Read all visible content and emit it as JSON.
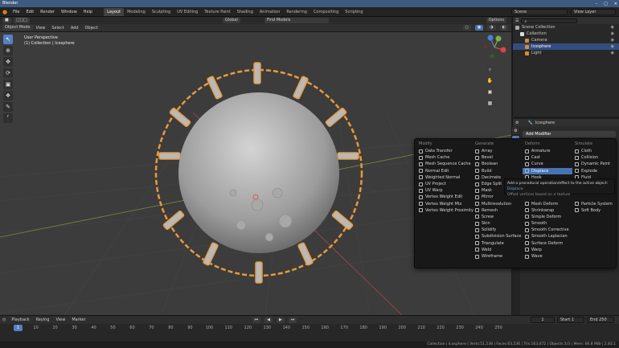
{
  "window": {
    "title": "Blender"
  },
  "menu": [
    "File",
    "Edit",
    "Render",
    "Window",
    "Help"
  ],
  "workspaces": [
    "Layout",
    "Modeling",
    "Sculpting",
    "UV Editing",
    "Texture Paint",
    "Shading",
    "Animation",
    "Rendering",
    "Compositing",
    "Scripting"
  ],
  "active_workspace": "Layout",
  "scene": {
    "label": "Scene",
    "view_layer": "View Layer"
  },
  "viewport": {
    "mode": "Object Mode",
    "menus": [
      "View",
      "Select",
      "Add",
      "Object"
    ],
    "transform": "Global",
    "snap": "Find Models",
    "options": "Options",
    "overlay_line1": "User Perspective",
    "overlay_line2": "(1) Collection | Icosphere"
  },
  "outliner": {
    "rows": [
      {
        "label": "Scene Collection",
        "selected": false,
        "color": "#aaaaaa"
      },
      {
        "label": "Collection",
        "selected": false,
        "color": "#dddddd"
      },
      {
        "label": "Camera",
        "selected": false,
        "color": "#d58c3f"
      },
      {
        "label": "Icosphere",
        "selected": true,
        "color": "#d58c3f"
      },
      {
        "label": "Light",
        "selected": false,
        "color": "#d58c3f"
      }
    ]
  },
  "properties": {
    "object_name": "Icosphere",
    "add_modifier": "Add Modifier"
  },
  "modifier_menu": {
    "columns": [
      {
        "title": "Modify",
        "items": [
          "Data Transfer",
          "Mesh Cache",
          "Mesh Sequence Cache",
          "Normal Edit",
          "Weighted Normal",
          "UV Project",
          "UV Warp",
          "Vertex Weight Edit",
          "Vertex Weight Mix",
          "Vertex Weight Proximity"
        ]
      },
      {
        "title": "Generate",
        "items": [
          "Array",
          "Bevel",
          "Boolean",
          "Build",
          "Decimate",
          "Edge Split",
          "Mask",
          "Mirror",
          "Multiresolution",
          "Remesh",
          "Screw",
          "Skin",
          "Solidify",
          "Subdivision Surface",
          "Triangulate",
          "Weld",
          "Wireframe"
        ]
      },
      {
        "title": "Deform",
        "items": [
          "Armature",
          "Cast",
          "Curve",
          "Displace",
          "Hook",
          "",
          "",
          "",
          "Mesh Deform",
          "Shrinkwrap",
          "Simple Deform",
          "Smooth",
          "Smooth Corrective",
          "Smooth Laplacian",
          "Surface Deform",
          "Warp",
          "Wave"
        ]
      },
      {
        "title": "Simulate",
        "items": [
          "Cloth",
          "Collision",
          "Dynamic Paint",
          "Explode",
          "Fluid",
          "",
          "",
          "",
          "Particle System",
          "Soft Body"
        ]
      }
    ],
    "highlighted": "Displace",
    "tooltip_line1": "Add a procedural operation/effect to the active object:",
    "tooltip_name": "Displace",
    "tooltip_line2": "Offset vertices based on a texture"
  },
  "timeline": {
    "menus": [
      "Playback",
      "Keying",
      "View",
      "Marker"
    ],
    "current_frame": "1",
    "start_label": "Start",
    "start": "1",
    "end_label": "End",
    "end": "250",
    "ticks": [
      "1",
      "10",
      "20",
      "30",
      "40",
      "50",
      "60",
      "70",
      "80",
      "90",
      "100",
      "110",
      "120",
      "130",
      "140",
      "150",
      "160",
      "170",
      "180",
      "190",
      "200",
      "210",
      "220",
      "230",
      "240",
      "250"
    ]
  },
  "status": {
    "text": "Collection | Icosphere | Verts:51,538 | Faces:63,536 | Tris:163,072 | Objects:1/3 | Mem: 66.8 MiB | 2.83.1"
  },
  "colors": {
    "accent": "#4772b3",
    "selection_outline": "#e89a3c",
    "title_bar": "#3d5a80"
  }
}
